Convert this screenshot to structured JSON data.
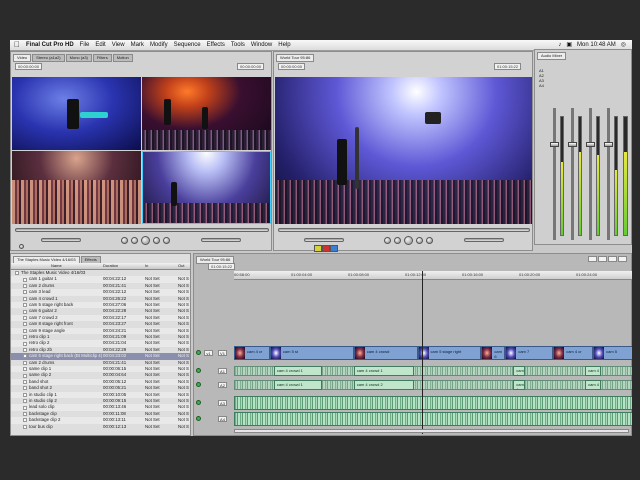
{
  "menubar": {
    "apple": "",
    "items": [
      "Final Cut Pro HD",
      "File",
      "Edit",
      "View",
      "Mark",
      "Modify",
      "Sequence",
      "Effects",
      "Tools",
      "Window",
      "Help"
    ],
    "clock": "Mon 10:48 AM"
  },
  "viewer": {
    "tabs": [
      "Video",
      "Stereo (a1a2)",
      "Mono (a3)",
      "Filters",
      "Motion"
    ],
    "timecode_left": "00:00:00:00",
    "timecode_right": "00:00:00:00"
  },
  "canvas": {
    "tab": "World Tour 95:86",
    "timecode_left": "00:00:00:00",
    "timecode_right": "01:00:15:22"
  },
  "audio_mixer": {
    "title": "Audio Mixer",
    "tracks": [
      "A1",
      "A2",
      "A3",
      "A4"
    ],
    "meter_levels": [
      0.62,
      0.7,
      0.68,
      0.55
    ]
  },
  "browser": {
    "project": "The Staples Music Video 4/16/03",
    "tab_small": "Effects",
    "columns": [
      "Name",
      "Duration",
      "In",
      "Out"
    ],
    "rows": [
      {
        "name": "The Staples Music Video 4/16/03",
        "duration": "",
        "in": "",
        "out": ""
      },
      {
        "name": "cam 1 guitar 1",
        "duration": "00:04:22:12",
        "in": "Not Set",
        "out": "Not S"
      },
      {
        "name": "cam 2 drums",
        "duration": "00:04:21:41",
        "in": "Not Set",
        "out": "Not S"
      },
      {
        "name": "cam 3 lead",
        "duration": "00:04:22:12",
        "in": "Not Set",
        "out": "Not S"
      },
      {
        "name": "cam 4 crowd 1",
        "duration": "00:04:26:22",
        "in": "Not Set",
        "out": "Not S"
      },
      {
        "name": "cam 5 stage right back",
        "duration": "00:04:27:06",
        "in": "Not Set",
        "out": "Not S"
      },
      {
        "name": "cam 6 guitar 2",
        "duration": "00:04:22:28",
        "in": "Not Set",
        "out": "Not S"
      },
      {
        "name": "cam 7 crowd 2",
        "duration": "00:04:22:17",
        "in": "Not Set",
        "out": "Not S"
      },
      {
        "name": "cam 8 stage right front",
        "duration": "00:04:23:27",
        "in": "Not Set",
        "out": "Not S"
      },
      {
        "name": "cam 9 stage angle",
        "duration": "00:04:24:21",
        "in": "Not Set",
        "out": "Not S"
      },
      {
        "name": "retro clip 1",
        "duration": "00:04:21:09",
        "in": "Not Set",
        "out": "Not S"
      },
      {
        "name": "retro clip 2",
        "duration": "00:04:21:04",
        "in": "Not Set",
        "out": "Not S"
      },
      {
        "name": "retro clip 2b",
        "duration": "00:04:22:29",
        "in": "Not Set",
        "out": "Not S"
      },
      {
        "name": "cam 5 stage right back (Bt Multiclip 4)",
        "duration": "00:04:23:02",
        "in": "Not Set",
        "out": "Not S"
      },
      {
        "name": "cam 2 drums",
        "duration": "00:04:21:41",
        "in": "Not Set",
        "out": "Not S"
      },
      {
        "name": "same clip 1",
        "duration": "00:00:06:15",
        "in": "Not Set",
        "out": "Not S"
      },
      {
        "name": "same clip 2",
        "duration": "00:00:04:64",
        "in": "Not Set",
        "out": "Not S"
      },
      {
        "name": "band shot",
        "duration": "00:00:05:12",
        "in": "Not Set",
        "out": "Not S"
      },
      {
        "name": "band shot 2",
        "duration": "00:00:05:21",
        "in": "Not Set",
        "out": "Not S"
      },
      {
        "name": "in studio clip 1",
        "duration": "00:00:10:05",
        "in": "Not Set",
        "out": "Not S"
      },
      {
        "name": "in studio clip 2",
        "duration": "00:00:09:15",
        "in": "Not Set",
        "out": "Not S"
      },
      {
        "name": "lead solo clip",
        "duration": "00:00:13:46",
        "in": "Not Set",
        "out": "Not S"
      },
      {
        "name": "backstage clip",
        "duration": "00:00:11:08",
        "in": "Not Set",
        "out": "Not S"
      },
      {
        "name": "backstage clip 2",
        "duration": "00:00:13:11",
        "in": "Not Set",
        "out": "Not S"
      },
      {
        "name": "tour bus clip",
        "duration": "00:00:12:13",
        "in": "Not Set",
        "out": "Not S"
      }
    ],
    "selected_row": 13
  },
  "timeline": {
    "tab": "World Tour 95:86",
    "timecode": "01:00:15:22",
    "ruler": [
      "00:58:00",
      "01:00:04:00",
      "01:00:08:00",
      "01:00:12:00",
      "01:00:16:00",
      "01:00:20:00",
      "01:00:24:00"
    ],
    "video_track_label": "V1",
    "audio_track_labels": [
      "A1",
      "A2",
      "A3",
      "A4"
    ],
    "video_clips": [
      {
        "label": "cam 4 cr",
        "start": 0.0,
        "end": 0.09
      },
      {
        "label": "cam 5 st",
        "start": 0.09,
        "end": 0.3
      },
      {
        "label": "cam 4 crowd",
        "start": 0.3,
        "end": 0.46
      },
      {
        "label": "cam 5 stage right",
        "start": 0.46,
        "end": 0.62
      },
      {
        "label": "cam 6",
        "start": 0.62,
        "end": 0.68
      },
      {
        "label": "cam 7",
        "start": 0.68,
        "end": 0.8
      },
      {
        "label": "cam 4 cr",
        "start": 0.8,
        "end": 0.9
      },
      {
        "label": "cam 5",
        "start": 0.9,
        "end": 1.0
      }
    ],
    "audio_clips_a1": [
      {
        "label": "cam 4 crowd 1",
        "start": 0.1,
        "end": 0.22
      },
      {
        "label": "cam 4 crowd 1",
        "start": 0.3,
        "end": 0.45
      },
      {
        "label": "cam 4",
        "start": 0.7,
        "end": 0.73
      },
      {
        "label": "cam 4",
        "start": 0.88,
        "end": 0.92
      }
    ],
    "audio_clips_a2": [
      {
        "label": "cam 4 crowd 1",
        "start": 0.1,
        "end": 0.22
      },
      {
        "label": "cam 4 crowd 2",
        "start": 0.3,
        "end": 0.45
      },
      {
        "label": "cam 4",
        "start": 0.7,
        "end": 0.73
      },
      {
        "label": "cam 4",
        "start": 0.88,
        "end": 0.92
      }
    ],
    "playhead": 0.47
  }
}
